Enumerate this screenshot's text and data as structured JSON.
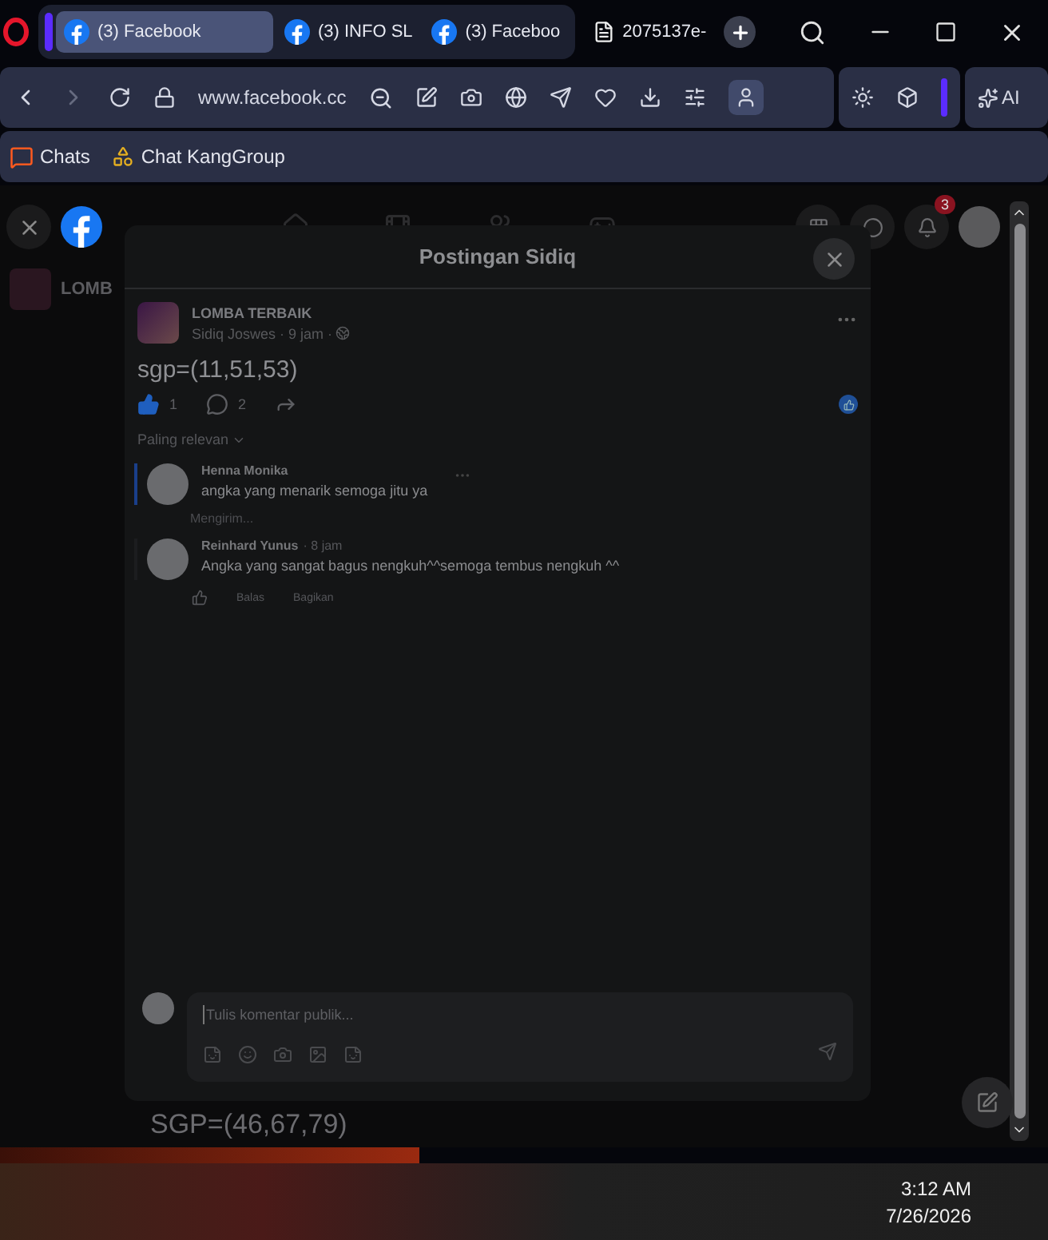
{
  "browser": {
    "tabs": [
      {
        "title": "(3) Facebook",
        "selected": true,
        "kind": "facebook"
      },
      {
        "title": "(3) INFO SL",
        "selected": false,
        "kind": "facebook"
      },
      {
        "title": "(3) Faceboo",
        "selected": false,
        "kind": "facebook"
      },
      {
        "title": "2075137e-",
        "selected": false,
        "kind": "file"
      }
    ],
    "address": "www.facebook.cc",
    "bookmarks": [
      {
        "label": "Chats",
        "kind": "chat"
      },
      {
        "label": "Chat KangGroup",
        "kind": "apps"
      }
    ],
    "ai_button": "AI"
  },
  "background_page": {
    "notifications_badge": "3",
    "group_name": "LOMB",
    "post_text": "SGP=(46,67,79)"
  },
  "dialog": {
    "title": "Postingan Sidiq",
    "post": {
      "group": "LOMBA TERBAIK",
      "author_meta": "Sidiq Joswes · 9 jam ·",
      "text": "sgp=(11,51,53)",
      "likes": "1",
      "comments": "2"
    },
    "sort": "Paling relevan",
    "comments": [
      {
        "author": "Henna Monika",
        "text": "angka yang menarik semoga jitu ya",
        "status": "Mengirim...",
        "highlighted": true
      },
      {
        "author": "Reinhard Yunus",
        "time": "· 8 jam",
        "text": "Angka yang sangat bagus nengkuh^^semoga tembus nengkuh ^^",
        "actions": [
          "Balas",
          "Bagikan"
        ],
        "highlighted": false
      }
    ],
    "composer": {
      "placeholder": "Tulis komentar publik..."
    }
  },
  "taskbar": {
    "time": "3:12 AM",
    "date": "7/26/2026"
  }
}
